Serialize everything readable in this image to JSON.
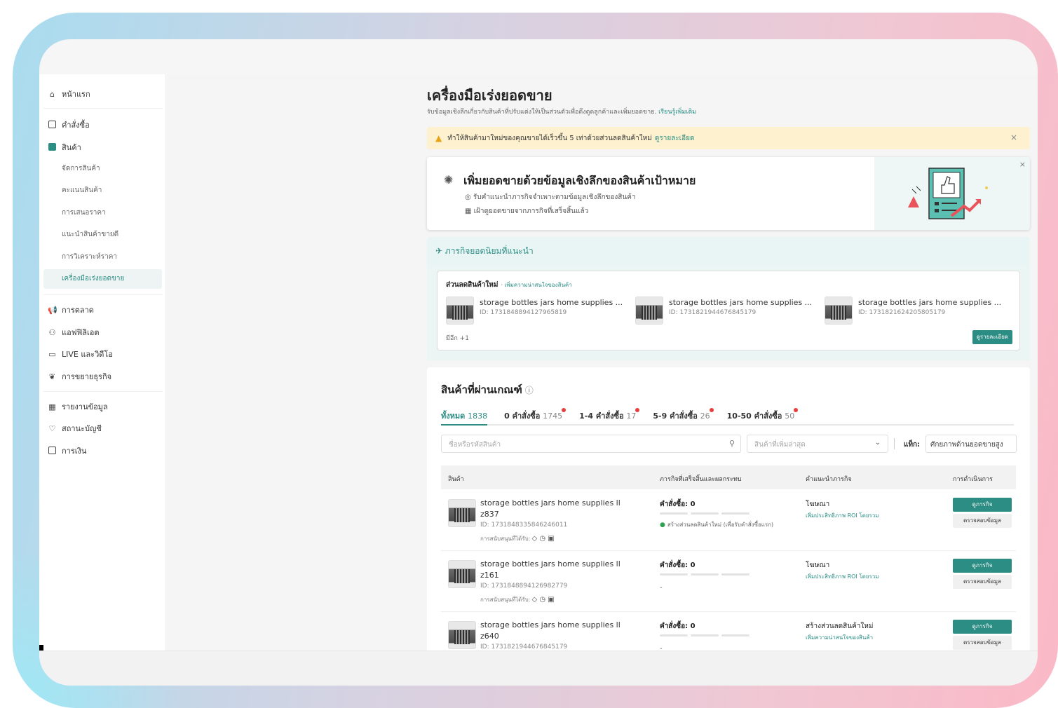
{
  "sidebar": {
    "home": "หน้าแรก",
    "orders": "คำสั่งซื้อ",
    "products": "สินค้า",
    "product_subitems": [
      "จัดการสินค้า",
      "คะแนนสินค้า",
      "การเสนอราคา",
      "แนะนำสินค้าขายดี",
      "การวิเคราะห์ราคา",
      "เครื่องมือเร่งยอดขาย"
    ],
    "marketing": "การตลาด",
    "affiliate": "แอฟฟิลิเอต",
    "live_video": "LIVE และวิดีโอ",
    "business_growth": "การขยายธุรกิจ",
    "data_report": "รายงานข้อมูล",
    "account_status": "สถานะบัญชี",
    "finance": "การเงิน"
  },
  "header": {
    "title": "เครื่องมือเร่งยอดขาย",
    "description": "รับข้อมูลเชิงลึกเกี่ยวกับสินค้าที่ปรับแต่งให้เป็นส่วนตัวเพื่อดึงดูดลูกค้าและเพิ่มยอดขาย.",
    "learn_more": "เรียนรู้เพิ่มเติม"
  },
  "alert": {
    "text": "ทำให้สินค้ามาใหม่ของคุณขายได้เร็วขึ้น 5 เท่าด้วยส่วนลดสินค้าใหม่",
    "link": "ดูรายละเอียด",
    "close": "×"
  },
  "promo": {
    "title": "เพิ่มยอดขายด้วยข้อมูลเชิงลึกของสินค้าเป้าหมาย",
    "line1": "รับคำแนะนำภารกิจจำเพาะตามข้อมูลเชิงลึกของสินค้า",
    "line2": "เฝ้าดูยอดขายจากภารกิจที่เสร็จสิ้นแล้ว",
    "close": "×"
  },
  "missions": {
    "heading": "ภารกิจยอดนิยมที่แนะนำ",
    "card_title": "ส่วนลดสินค้าใหม่",
    "card_subtitle": "· เพิ่มความน่าสนใจของสินค้า",
    "products": [
      {
        "name": "storage bottles jars home supplies ...",
        "id": "ID: 1731848894127965819"
      },
      {
        "name": "storage bottles jars home supplies ...",
        "id": "ID: 1731821944676845179"
      },
      {
        "name": "storage bottles jars home supplies ...",
        "id": "ID: 1731821624205805179"
      }
    ],
    "more": "มีอีก +1",
    "details_button": "ดูรายละเอียด"
  },
  "qualified": {
    "title": "สินค้าที่ผ่านเกณฑ์",
    "help_icon": "ⓘ",
    "tabs": [
      {
        "label": "ทั้งหมด",
        "count": "1838"
      },
      {
        "label": "0 คำสั่งซื้อ",
        "count": "1745"
      },
      {
        "label": "1-4 คำสั่งซื้อ",
        "count": "17"
      },
      {
        "label": "5-9 คำสั่งซื้อ",
        "count": "26"
      },
      {
        "label": "10-50 คำสั่งซื้อ",
        "count": "50"
      }
    ],
    "search_placeholder": "ชื่อหรือรหัสสินค้า",
    "filter_placeholder": "สินค้าที่เพิ่มล่าสุด",
    "sort_label": "แท็ก:",
    "sort_value": "ศักยภาพด้านยอดขายสูง",
    "columns": [
      "สินค้า",
      "ภารกิจที่เสร็จสิ้นและผลกระทบ",
      "คำแนะนำภารกิจ",
      "การดำเนินการ"
    ],
    "rows": [
      {
        "name": "storage bottles jars home supplies ll z837",
        "id": "ID: 1731848335846246011",
        "support": "การสนับสนุนที่ได้รับ:",
        "orders": "คำสั่งซื้อ: 0",
        "status": "สร้างส่วนลดสินค้าใหม่ (เพื่อรับคำสั่งซื้อแรก)",
        "rec": "โฆษณา",
        "rec_sub": "เพิ่มประสิทธิภาพ ROI โดยรวม",
        "btn_main": "ดูภารกิจ",
        "btn_sec": "ตรวจสอบข้อมูล"
      },
      {
        "name": "storage bottles jars home supplies ll z161",
        "id": "ID: 1731848894126982779",
        "support": "การสนับสนุนที่ได้รับ:",
        "orders": "คำสั่งซื้อ: 0",
        "status": "-",
        "rec": "โฆษณา",
        "rec_sub": "เพิ่มประสิทธิภาพ ROI โดยรวม",
        "btn_main": "ดูภารกิจ",
        "btn_sec": "ตรวจสอบข้อมูล"
      },
      {
        "name": "storage bottles jars home supplies ll z640",
        "id": "ID: 1731821944676845179",
        "support": "",
        "orders": "คำสั่งซื้อ: 0",
        "status": "-",
        "rec": "สร้างส่วนลดสินค้าใหม่",
        "rec_sub": "เพิ่มความน่าสนใจของสินค้า",
        "btn_main": "ดูภารกิจ",
        "btn_sec": "ตรวจสอบข้อมูล"
      }
    ]
  },
  "colors": {
    "accent": "#2b8d84",
    "alert_bg": "#fdf1cf",
    "badge_dot": "#e83e3e"
  }
}
